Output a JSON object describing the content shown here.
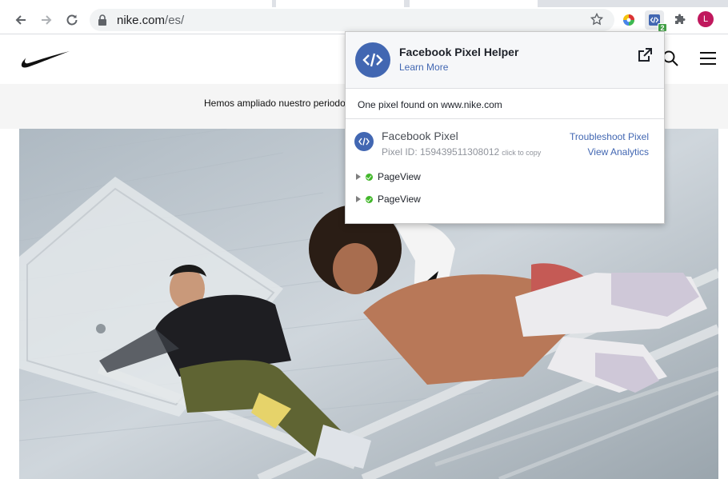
{
  "browser": {
    "url_host": "nike.com",
    "url_path": "/es/",
    "avatar_letter": "L",
    "extension_badge": "2",
    "icons": [
      "back-arrow-icon",
      "forward-arrow-icon",
      "reload-icon",
      "lock-icon",
      "star-icon",
      "color-wheel-icon",
      "pixel-helper-icon",
      "puzzle-icon"
    ]
  },
  "nike": {
    "promo": "Hemos ampliado nuestro periodo",
    "icons": [
      "nike-swoosh-icon",
      "search-icon",
      "menu-icon"
    ]
  },
  "popup": {
    "title": "Facebook Pixel Helper",
    "learn_more": "Learn More",
    "found": "One pixel found on www.nike.com",
    "pixel_name": "Facebook Pixel",
    "pixel_id": "Pixel ID: 159439511308012",
    "click_to_copy": "click to copy",
    "troubleshoot": "Troubleshoot Pixel",
    "analytics": "View Analytics",
    "events": [
      "PageView",
      "PageView"
    ],
    "accent": "#4267b2",
    "success": "#42b72a"
  }
}
